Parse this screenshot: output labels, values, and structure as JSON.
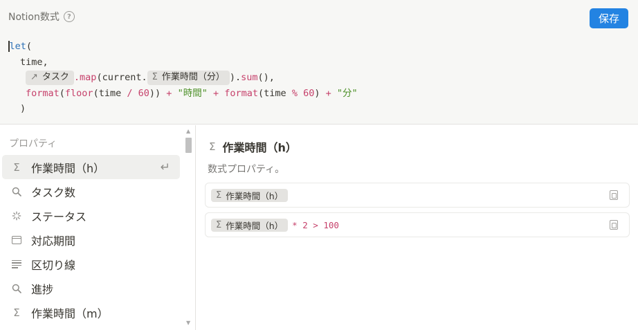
{
  "editor": {
    "title": "Notion数式",
    "help_icon": "?",
    "save_label": "保存",
    "code": {
      "l1_kw": "let",
      "l1_paren": "(",
      "l2": "time,",
      "chip1_icon": "↗",
      "chip1_label": "タスク",
      "l3_map": ".map",
      "l3_current": "(current.",
      "chip2_icon": "Σ",
      "chip2_label": "作業時間（分）",
      "l3_tail_a": ").",
      "l3_sum": "sum",
      "l3_tail_b": "(),",
      "l4_format1": "format",
      "l4_p1": "(",
      "l4_floor": "floor",
      "l4_p2": "(time ",
      "l4_div": "/",
      "l4_sp": " ",
      "l4_60a": "60",
      "l4_p3": ")) ",
      "l4_plus1": "+",
      "l4_sp2": " ",
      "l4_str1": "\"時間\"",
      "l4_sp3": " ",
      "l4_plus2": "+",
      "l4_sp4": " ",
      "l4_format2": "format",
      "l4_p4": "(time ",
      "l4_mod": "%",
      "l4_sp5": " ",
      "l4_60b": "60",
      "l4_p5": ") ",
      "l4_plus3": "+",
      "l4_sp6": " ",
      "l4_str2": "\"分\"",
      "l5": ")"
    }
  },
  "properties": {
    "section_label": "プロパティ",
    "items": [
      {
        "icon": "Σ",
        "label": "作業時間（h）"
      },
      {
        "icon": "⚲",
        "label": "タスク数"
      },
      {
        "icon": "✳",
        "label": "ステータス"
      },
      {
        "icon": "calendar",
        "label": "対応期間"
      },
      {
        "icon": "lines",
        "label": "区切り線"
      },
      {
        "icon": "⚲",
        "label": "進捗"
      },
      {
        "icon": "Σ",
        "label": "作業時間（m）"
      }
    ],
    "selected_enter_icon": "↵"
  },
  "detail": {
    "title_icon": "Σ",
    "title": "作業時間（h）",
    "subtitle": "数式プロパティ。",
    "example1": {
      "chip_icon": "Σ",
      "chip_label": "作業時間（h）"
    },
    "example2": {
      "chip_icon": "Σ",
      "chip_label": "作業時間（h）",
      "op1": "*",
      "num1": "2",
      "op2": ">",
      "num2": "100"
    }
  },
  "colors": {
    "accent": "#2383e2",
    "keyword": "#2b6fb5",
    "function": "#c6416b",
    "string": "#4b8f26"
  }
}
